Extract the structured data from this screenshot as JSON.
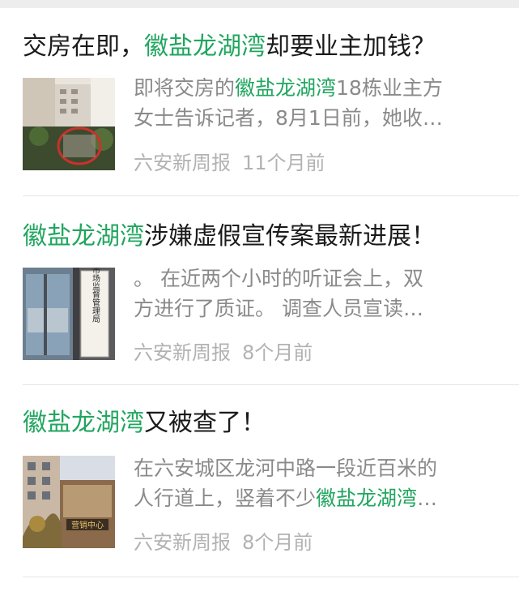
{
  "articles": [
    {
      "title": {
        "before": "交房在即，",
        "highlight": "徽盐龙湖湾",
        "after": "却要业主加钱？"
      },
      "digest": {
        "line1_before": "即将交房的",
        "line1_highlight": "徽盐龙湖湾",
        "line1_after": "18栋业主方",
        "line2": "女士告诉记者，8月1日前，她收…"
      },
      "source": "六安新周报",
      "time": "11个月前",
      "thumb_icon": "building-model-photo"
    },
    {
      "title": {
        "before": "",
        "highlight": "徽盐龙湖湾",
        "after": "涉嫌虚假宣传案最新进展！"
      },
      "digest": {
        "line1": "。 在近两个小时的听证会上，双",
        "line2": "方进行了质证。 调查人员宣读…"
      },
      "source": "六安新周报",
      "time": "8个月前",
      "thumb_icon": "office-door-sign-photo",
      "thumb_sign_text": "六安市市场监督管理局"
    },
    {
      "title": {
        "before": "",
        "highlight": "徽盐龙湖湾",
        "after": "又被查了！"
      },
      "digest": {
        "line1": "在六安城区龙河中路一段近百米的",
        "line2_before": "人行道上，竖着不少",
        "line2_highlight": "徽盐龙湖湾",
        "line2_after": "…"
      },
      "source": "六安新周报",
      "time": "8个月前",
      "thumb_icon": "sales-center-photo",
      "thumb_sign_text": "营销中心"
    }
  ]
}
